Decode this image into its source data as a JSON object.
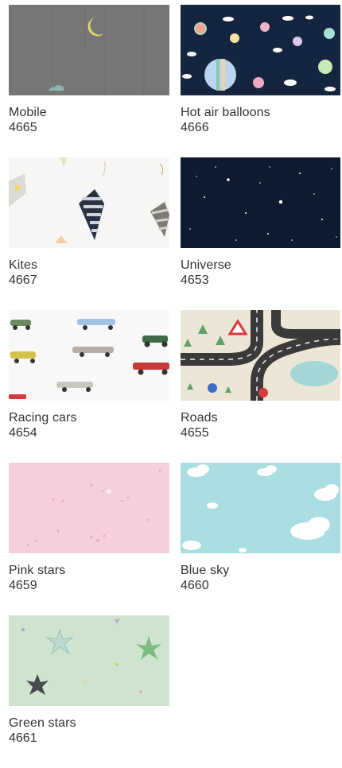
{
  "items": [
    {
      "name": "Mobile",
      "code": "4665"
    },
    {
      "name": "Hot air balloons",
      "code": "4666"
    },
    {
      "name": "Kites",
      "code": "4667"
    },
    {
      "name": "Universe",
      "code": "4653"
    },
    {
      "name": "Racing cars",
      "code": "4654"
    },
    {
      "name": "Roads",
      "code": "4655"
    },
    {
      "name": "Pink stars",
      "code": "4659"
    },
    {
      "name": "Blue sky",
      "code": "4660"
    },
    {
      "name": "Green stars",
      "code": "4661"
    }
  ],
  "colors": {
    "text": "#333333",
    "mobile_bg": "#767775",
    "balloons_bg": "#15243f",
    "kites_bg": "#f6f6f4",
    "universe_bg": "#0e1a30",
    "racing_bg": "#f8f8f8",
    "roads_bg": "#e9e3d3",
    "pink_bg": "#f5cfdb",
    "blue_bg": "#a9dde0",
    "green_bg": "#cfe3cf"
  }
}
